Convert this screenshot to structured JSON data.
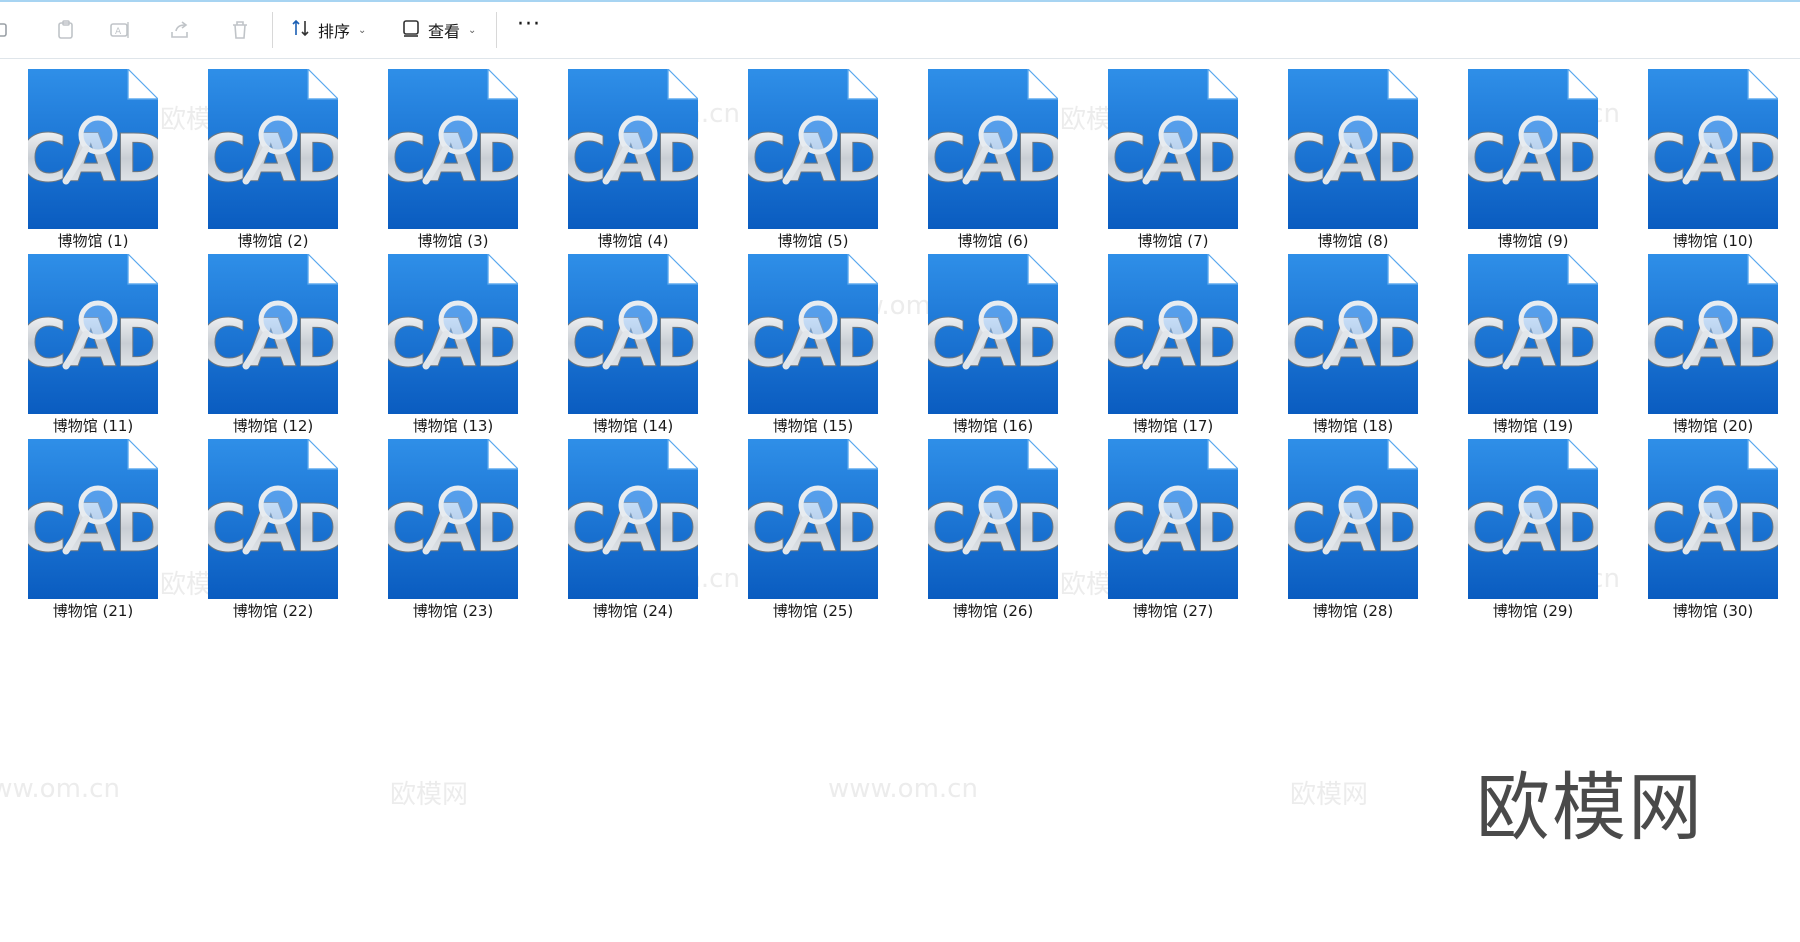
{
  "toolbar": {
    "icons": [
      "copy-icon",
      "paste-icon",
      "rename-icon",
      "share-icon",
      "delete-icon"
    ],
    "sort_label": "排序",
    "view_label": "查看",
    "more_label": "···"
  },
  "files": [
    "博物馆 (1)",
    "博物馆 (2)",
    "博物馆 (3)",
    "博物馆 (4)",
    "博物馆 (5)",
    "博物馆 (6)",
    "博物馆 (7)",
    "博物馆 (8)",
    "博物馆 (9)",
    "博物馆 (10)",
    "博物馆 (11)",
    "博物馆 (12)",
    "博物馆 (13)",
    "博物馆 (14)",
    "博物馆 (15)",
    "博物馆 (16)",
    "博物馆 (17)",
    "博物馆 (18)",
    "博物馆 (19)",
    "博物馆 (20)",
    "博物馆 (21)",
    "博物馆 (22)",
    "博物馆 (23)",
    "博物馆 (24)",
    "博物馆 (25)",
    "博物馆 (26)",
    "博物馆 (27)",
    "博物馆 (28)",
    "博物馆 (29)",
    "博物馆 (30)"
  ],
  "file_icon_text": "CAD",
  "watermark": {
    "site": "www.om.cn",
    "brand": "欧模网",
    "corner_logo": "欧模网"
  },
  "colors": {
    "icon_blue_light": "#2f8fe8",
    "icon_blue_dark": "#0a5cc0",
    "accent_line": "#a7d4f2"
  }
}
